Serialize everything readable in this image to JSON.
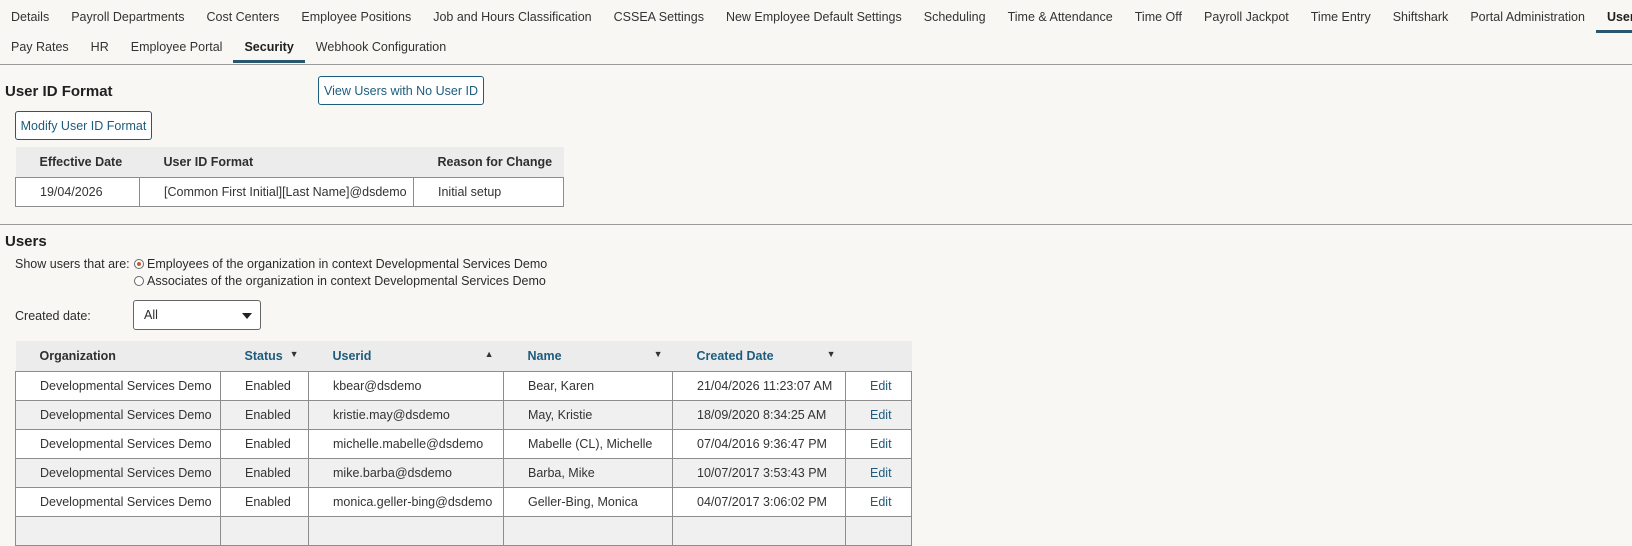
{
  "tabs_row1": [
    "Details",
    "Payroll Departments",
    "Cost Centers",
    "Employee Positions",
    "Job and Hours Classification",
    "CSSEA Settings",
    "New Employee Default Settings",
    "Scheduling",
    "Time & Attendance",
    "Time Off",
    "Payroll Jackpot",
    "Time Entry",
    "Shiftshark",
    "Portal Administration",
    "Users"
  ],
  "tabs_row2": [
    "Pay Rates",
    "HR",
    "Employee Portal",
    "Security",
    "Webhook Configuration"
  ],
  "user_id_format": {
    "title": "User ID Format",
    "view_no_id_button": "View Users with No User ID",
    "modify_button": "Modify User ID Format",
    "columns": [
      "Effective Date",
      "User ID Format",
      "Reason for Change"
    ],
    "rows": [
      [
        "19/04/2026",
        "[Common First Initial][Last Name]@dsdemo",
        "Initial setup"
      ]
    ]
  },
  "users": {
    "title": "Users",
    "show_label": "Show users that are:",
    "radio_employees": "Employees of the organization in context Developmental Services Demo",
    "radio_associates": "Associates of the organization in context Developmental Services Demo",
    "created_label": "Created date:",
    "created_value": "All",
    "columns": {
      "organization": "Organization",
      "status": "Status",
      "userid": "Userid",
      "name": "Name",
      "created": "Created Date"
    },
    "caret_down": "▼",
    "caret_up": "▲",
    "edit_label": "Edit",
    "rows": [
      {
        "org": "Developmental Services Demo",
        "status": "Enabled",
        "userid": "kbear@dsdemo",
        "name": "Bear, Karen",
        "created": "21/04/2026 11:23:07 AM"
      },
      {
        "org": "Developmental Services Demo",
        "status": "Enabled",
        "userid": "kristie.may@dsdemo",
        "name": "May, Kristie",
        "created": "18/09/2020 8:34:25 AM"
      },
      {
        "org": "Developmental Services Demo",
        "status": "Enabled",
        "userid": "michelle.mabelle@dsdemo",
        "name": "Mabelle (CL), Michelle",
        "created": "07/04/2016 9:36:47 PM"
      },
      {
        "org": "Developmental Services Demo",
        "status": "Enabled",
        "userid": "mike.barba@dsdemo",
        "name": "Barba, Mike",
        "created": "10/07/2017 3:53:43 PM"
      },
      {
        "org": "Developmental Services Demo",
        "status": "Enabled",
        "userid": "monica.geller-bing@dsdemo",
        "name": "Geller-Bing, Monica",
        "created": "04/07/2017 3:06:02 PM"
      },
      {
        "org": "",
        "status": "",
        "userid": "",
        "name": "",
        "created": ""
      }
    ]
  },
  "colors": {
    "accent": "#1d5c7d",
    "active_tab_underline": "#27566f",
    "radio_selected": "#c85a35",
    "background": "#f8f7f3"
  }
}
